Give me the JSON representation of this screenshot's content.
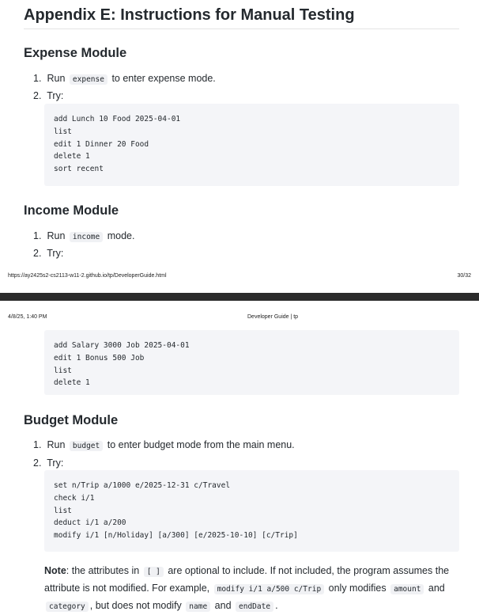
{
  "page1": {
    "title": "Appendix E: Instructions for Manual Testing",
    "expense": {
      "heading": "Expense Module",
      "step1_num": "1.",
      "step1_pre": "Run",
      "step1_code": "expense",
      "step1_post": "to enter expense mode.",
      "step2_num": "2.",
      "step2_text": "Try:",
      "code_lines": [
        "add Lunch 10 Food 2025-04-01",
        "list",
        "edit 1 Dinner 20 Food",
        "delete 1",
        "sort recent"
      ]
    },
    "income": {
      "heading": "Income Module",
      "step1_num": "1.",
      "step1_pre": "Run",
      "step1_code": "income",
      "step1_post": "mode.",
      "step2_num": "2.",
      "step2_text": "Try:"
    },
    "footer_url": "https://ay2425s2-cs2113-w11-2.github.io/tp/DeveloperGuide.html",
    "footer_page": "30/32"
  },
  "page2": {
    "header_date": "4/8/25, 1:40 PM",
    "header_title": "Developer Guide | tp",
    "income_code_lines": [
      "add Salary 3000 Job 2025-04-01",
      "edit 1 Bonus 500 Job",
      "list",
      "delete 1"
    ],
    "budget": {
      "heading": "Budget Module",
      "step1_num": "1.",
      "step1_pre": "Run",
      "step1_code": "budget",
      "step1_post": "to enter budget mode from the main menu.",
      "step2_num": "2.",
      "step2_text": "Try:",
      "code_lines": [
        "set n/Trip a/1000 e/2025-12-31 c/Travel",
        "check i/1",
        "list",
        "deduct i/1 a/200",
        "modify i/1 [n/Holiday] [a/300] [e/2025-10-10] [c/Trip]"
      ]
    },
    "note": {
      "label": "Note",
      "t1": ": the attributes in",
      "c1": "[ ]",
      "t2": "are optional to include. If not included, the program assumes the attribute is not modified. For example,",
      "c2": "modify i/1 a/500 c/Trip",
      "t3": "only modifies",
      "c3": "amount",
      "t4": "and",
      "c4": "category",
      "t5": ", but does not modify",
      "c5": "name",
      "t6": "and",
      "c6": "endDate",
      "t7": "."
    }
  }
}
